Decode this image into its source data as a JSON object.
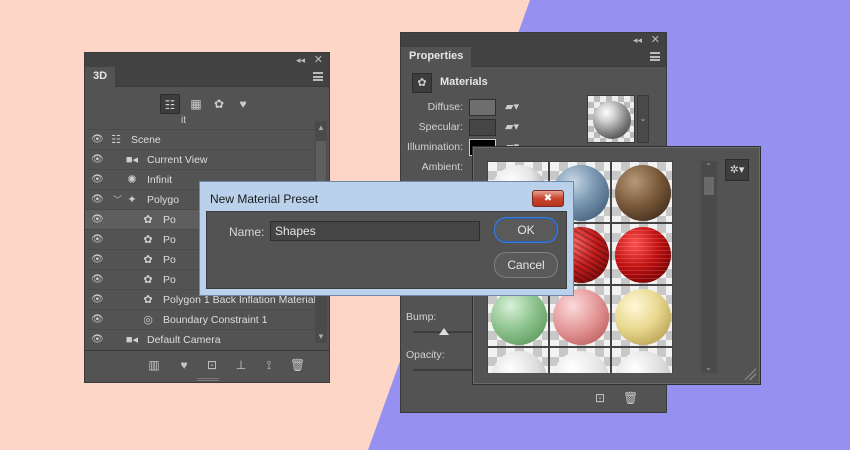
{
  "panel3d": {
    "tab": "3D",
    "toolbar_icons": [
      "scene-filter-icon",
      "mesh-filter-icon",
      "material-filter-icon",
      "light-filter-icon"
    ],
    "header_fragment": "it",
    "tree": [
      {
        "label": "Scene",
        "icon": "scene-icon",
        "indent": 0
      },
      {
        "label": "Current View",
        "icon": "camera-icon",
        "indent": 1
      },
      {
        "label": "Infinit",
        "icon": "sun-icon",
        "indent": 1
      },
      {
        "label": "Polygo",
        "icon": "mesh-icon",
        "indent": 1,
        "expanded": true
      },
      {
        "label": "Po",
        "icon": "material-icon",
        "indent": 2,
        "selected": true
      },
      {
        "label": "Po",
        "icon": "material-icon",
        "indent": 2
      },
      {
        "label": "Po",
        "icon": "material-icon",
        "indent": 2
      },
      {
        "label": "Po",
        "icon": "material-icon",
        "indent": 2
      },
      {
        "label": "Polygon 1 Back Inflation Material",
        "icon": "material-icon",
        "indent": 2
      },
      {
        "label": "Boundary Constraint 1",
        "icon": "constraint-icon",
        "indent": 2
      },
      {
        "label": "Default Camera",
        "icon": "camera-icon",
        "indent": 1
      }
    ]
  },
  "properties": {
    "tab": "Properties",
    "section": "Materials",
    "diffuse_label": "Diffuse:",
    "specular_label": "Specular:",
    "illumination_label": "Illumination:",
    "ambient_label": "Ambient:",
    "bump_label": "Bump:",
    "opacity_label": "Opacity:"
  },
  "dialog": {
    "title": "New Material Preset",
    "close_label": "✖",
    "name_label": "Name:",
    "name_value": "Shapes",
    "ok_label": "OK",
    "cancel_label": "Cancel"
  },
  "colors": {
    "bg_peach": "#fdd6c8",
    "bg_blue": "#9691f0",
    "panel": "#535353",
    "dialog_frame": "#b9d1ea",
    "ok_border": "#3a7be0"
  }
}
